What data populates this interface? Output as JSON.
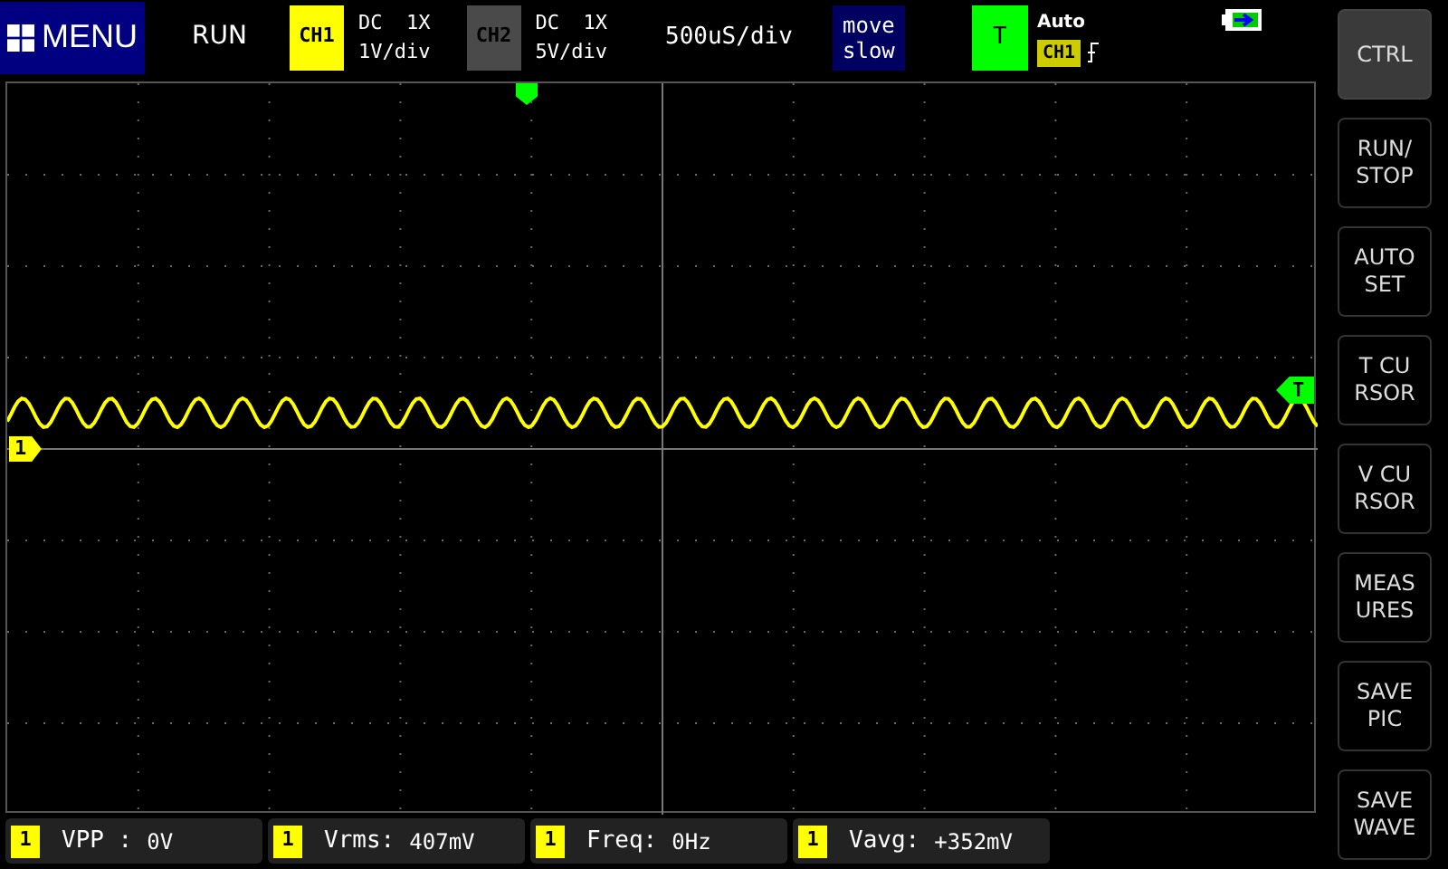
{
  "top_bar": {
    "menu": "MENU",
    "run_state": "RUN",
    "channels": [
      {
        "label": "CH1",
        "active": true,
        "coupling": "DC",
        "probe": "1X",
        "scale": "1V/div"
      },
      {
        "label": "CH2",
        "active": false,
        "coupling": "DC",
        "probe": "1X",
        "scale": "5V/div"
      }
    ],
    "timebase": "500uS/div",
    "move": [
      "move",
      "slow"
    ],
    "trigger": {
      "label": "T",
      "mode": "Auto",
      "source": "CH1"
    }
  },
  "screen": {
    "channel_marker": "1",
    "trigger_marker": "T"
  },
  "side_buttons": [
    {
      "label": [
        "CTRL"
      ],
      "selected": true
    },
    {
      "label": [
        "RUN/",
        "STOP"
      ],
      "selected": false
    },
    {
      "label": [
        "AUTO",
        "SET"
      ],
      "selected": false
    },
    {
      "label": [
        "T CU",
        "RSOR"
      ],
      "selected": false
    },
    {
      "label": [
        "V CU",
        "RSOR"
      ],
      "selected": false
    },
    {
      "label": [
        "MEAS",
        "URES"
      ],
      "selected": false
    },
    {
      "label": [
        "SAVE",
        "PIC"
      ],
      "selected": false
    },
    {
      "label": [
        "SAVE",
        "WAVE"
      ],
      "selected": false
    }
  ],
  "measurements": [
    {
      "channel": "1",
      "name": "VPP :",
      "value": "0V"
    },
    {
      "channel": "1",
      "name": "Vrms:",
      "value": "407mV"
    },
    {
      "channel": "1",
      "name": "Freq:",
      "value": "0Hz"
    },
    {
      "channel": "1",
      "name": "Vavg:",
      "value": "+352mV"
    }
  ]
}
